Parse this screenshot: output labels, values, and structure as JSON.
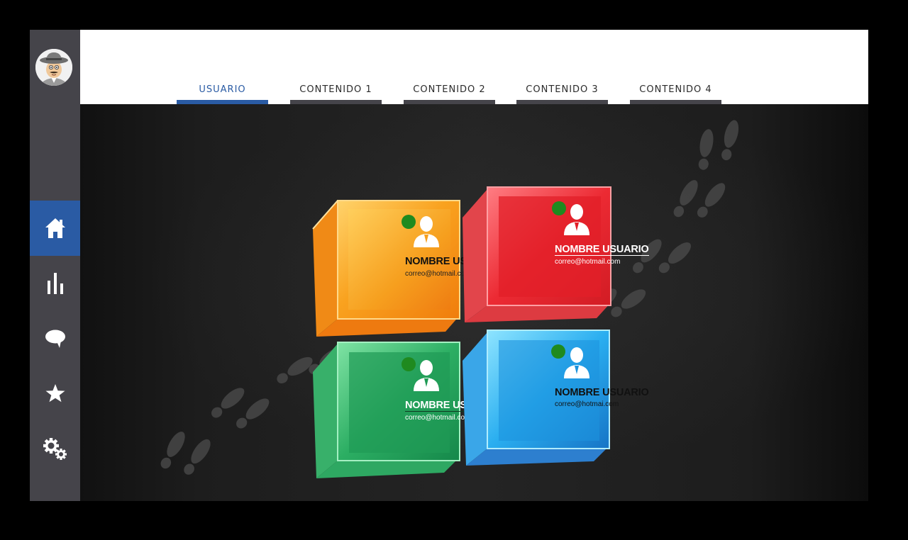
{
  "colors": {
    "accent": "#2a5ba4",
    "sidebar": "#45444a",
    "status_online": "#1f8a1f"
  },
  "sidebar": {
    "avatar_icon": "detective-avatar",
    "items": [
      {
        "name": "home",
        "icon": "home-icon",
        "active": true
      },
      {
        "name": "stats",
        "icon": "bar-chart-icon",
        "active": false
      },
      {
        "name": "chat",
        "icon": "speech-bubble-icon",
        "active": false
      },
      {
        "name": "favorites",
        "icon": "star-icon",
        "active": false
      },
      {
        "name": "settings",
        "icon": "gears-icon",
        "active": false
      }
    ]
  },
  "tabs": [
    {
      "label": "USUARIO",
      "active": true
    },
    {
      "label": "CONTENIDO 1",
      "active": false
    },
    {
      "label": "CONTENIDO 2",
      "active": false
    },
    {
      "label": "CONTENIDO 3",
      "active": false
    },
    {
      "label": "CONTENIDO 4",
      "active": false
    }
  ],
  "users": [
    {
      "name": "NOMBRE USUARIO",
      "email": "correo@hotmail.com",
      "color": "orange",
      "status": "online"
    },
    {
      "name": "NOMBRE USUARIO",
      "email": "correo@hotmail.com",
      "color": "red",
      "status": "online"
    },
    {
      "name": "NOMBRE USUARIO",
      "email": "correo@hotmail.com",
      "color": "green",
      "status": "online"
    },
    {
      "name": "NOMBRE USUARIO",
      "email": "correo@hotmai.com",
      "color": "blue",
      "status": "online"
    }
  ]
}
